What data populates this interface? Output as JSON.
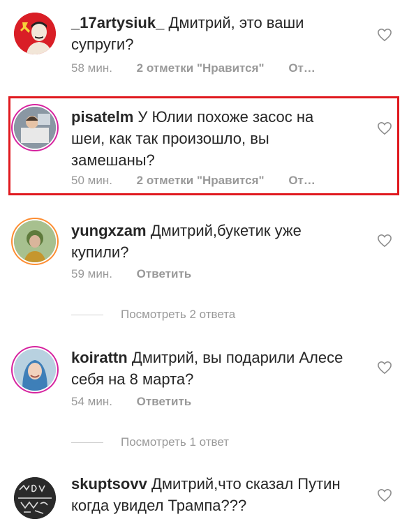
{
  "comments": [
    {
      "username": "_17artysiuk_",
      "text": "Дмитрий, это ваши супруги?",
      "time": "58 мин.",
      "likes": "2 отметки \"Нравится\"",
      "reply": "От…"
    },
    {
      "username": "pisatelm",
      "text": "У Юлии похоже засос на шеи, как так произошло, вы замешаны?",
      "time": "50 мин.",
      "likes": "2 отметки \"Нравится\"",
      "reply": "От…"
    },
    {
      "username": "yungxzam",
      "text": "Дмитрий,букетик уже купили?",
      "time": "59 мин.",
      "reply": "Ответить"
    },
    {
      "username": "koirattn",
      "text": "Дмитрий, вы подарили Алесе себя на 8 марта?",
      "time": "54 мин.",
      "reply": "Ответить"
    },
    {
      "username": "skuptsovv",
      "text": "Дмитрий,что сказал Путин когда увидел Трампа???"
    }
  ],
  "view_replies": [
    "Посмотреть 2 ответа",
    "Посмотреть 1 ответ"
  ],
  "colors": {
    "highlight": "#e0191f",
    "muted": "#999999",
    "text": "#262626"
  },
  "icons": {
    "like": "heart-outline-icon"
  }
}
